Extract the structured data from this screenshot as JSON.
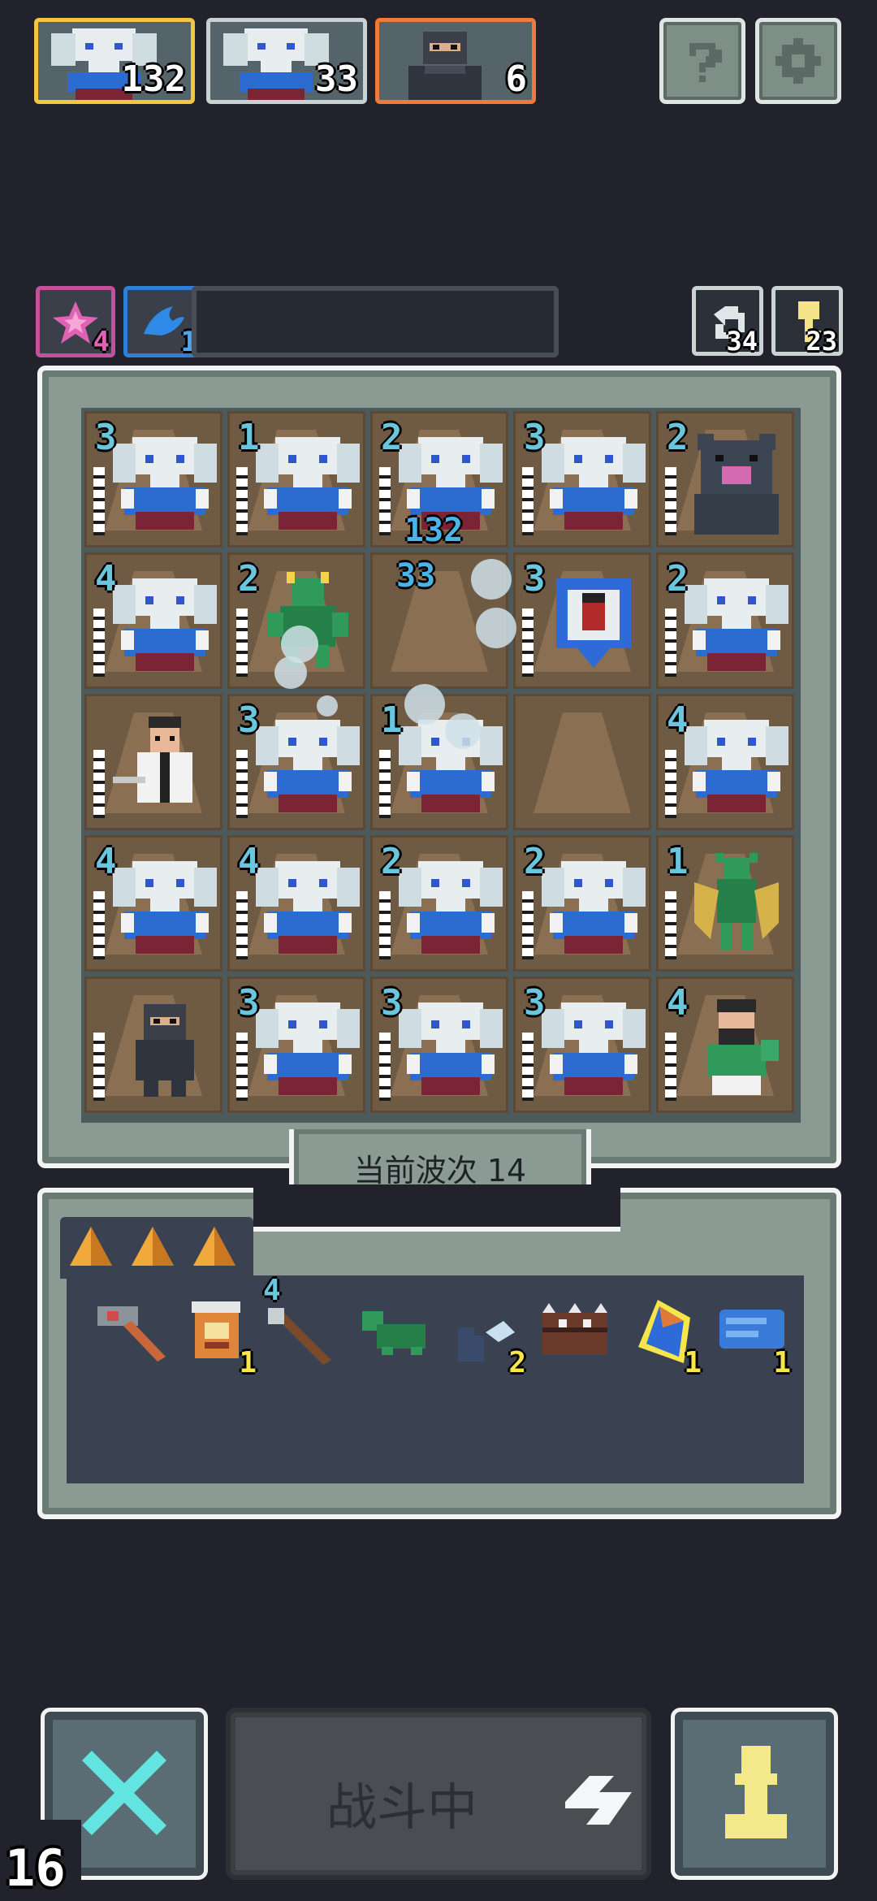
{
  "heroes": [
    {
      "name": "elephant-warrior",
      "count": "132",
      "frame": "#f4c541"
    },
    {
      "name": "elephant-warrior",
      "count": "33",
      "frame": "#c8d2d2"
    },
    {
      "name": "ninja",
      "count": "6",
      "frame": "#ee7b3a"
    }
  ],
  "top_buttons": {
    "help_icon": "question-icon",
    "settings_icon": "gear-icon"
  },
  "buffs": [
    {
      "icon": "pink-star-icon",
      "count": "4",
      "color": "#c44f9a"
    },
    {
      "icon": "blue-splash-icon",
      "count": "1",
      "color": "#2f7fd8"
    }
  ],
  "resources": [
    {
      "icon": "refresh-icon",
      "count": "34"
    },
    {
      "icon": "key-icon",
      "count": "23"
    }
  ],
  "board": {
    "rows": [
      [
        {
          "unit": "elephant",
          "level": "3"
        },
        {
          "unit": "elephant",
          "level": "1"
        },
        {
          "unit": "elephant",
          "level": "2"
        },
        {
          "unit": "elephant",
          "level": "3"
        },
        {
          "unit": "bear",
          "level": "2"
        }
      ],
      [
        {
          "unit": "elephant",
          "level": "4"
        },
        {
          "unit": "dragon",
          "level": "2"
        },
        {
          "unit": "empty",
          "level": ""
        },
        {
          "unit": "shrine",
          "level": "3"
        },
        {
          "unit": "elephant",
          "level": "2"
        }
      ],
      [
        {
          "unit": "scholar",
          "level": ""
        },
        {
          "unit": "elephant",
          "level": "3"
        },
        {
          "unit": "elephant",
          "level": "1"
        },
        {
          "unit": "empty",
          "level": ""
        },
        {
          "unit": "elephant",
          "level": "4"
        }
      ],
      [
        {
          "unit": "elephant",
          "level": "4"
        },
        {
          "unit": "elephant",
          "level": "4"
        },
        {
          "unit": "elephant",
          "level": "2"
        },
        {
          "unit": "elephant",
          "level": "2"
        },
        {
          "unit": "mantis",
          "level": "1"
        }
      ],
      [
        {
          "unit": "ninja",
          "level": ""
        },
        {
          "unit": "elephant",
          "level": "3"
        },
        {
          "unit": "elephant",
          "level": "3"
        },
        {
          "unit": "elephant",
          "level": "3"
        },
        {
          "unit": "warrior",
          "level": "4"
        }
      ]
    ],
    "damage_popups": [
      "132",
      "33"
    ]
  },
  "wave": {
    "label": "当前波次 14"
  },
  "inventory": {
    "tabs": [
      "triangle-icon",
      "triangle-icon",
      "triangle-icon"
    ],
    "items": [
      {
        "icon": "hammer-icon",
        "count": "",
        "level": ""
      },
      {
        "icon": "lantern-icon",
        "count": "1",
        "level": ""
      },
      {
        "icon": "staff-icon",
        "count": "",
        "level": "4"
      },
      {
        "icon": "turtle-icon",
        "count": "",
        "level": ""
      },
      {
        "icon": "wing-boot-icon",
        "count": "2",
        "level": ""
      },
      {
        "icon": "spiked-chest-icon",
        "count": "",
        "level": ""
      },
      {
        "icon": "crystal-icon",
        "count": "1",
        "level": ""
      },
      {
        "icon": "scroll-icon",
        "count": "1",
        "level": ""
      }
    ]
  },
  "controls": {
    "battle_label": "战斗中",
    "speed": "16",
    "left_icon": "crossed-swords-icon",
    "right_icon": "pawn-icon"
  },
  "colors": {
    "background": "#22222c",
    "frame": "#8b9b94",
    "tile": "#8a6f52",
    "accent_cyan": "#69c6dd",
    "accent_yellow": "#f6e64a"
  }
}
